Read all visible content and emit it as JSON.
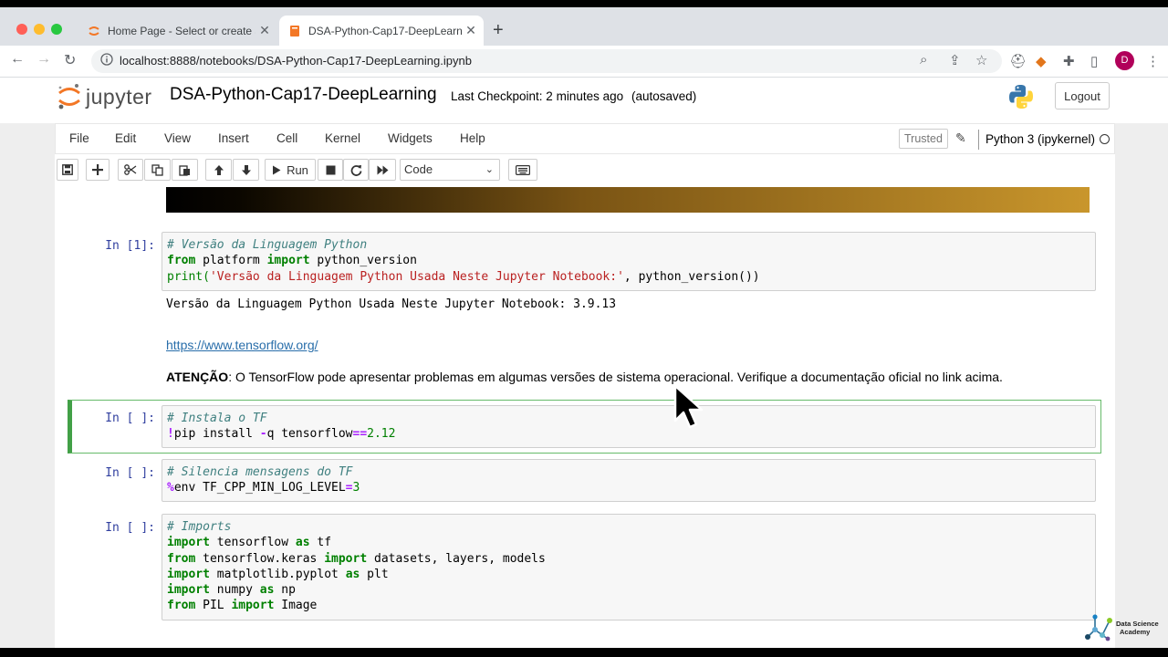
{
  "browser": {
    "tabs": [
      {
        "title": "Home Page - Select or create a",
        "active": false
      },
      {
        "title": "DSA-Python-Cap17-DeepLearni",
        "active": true
      }
    ],
    "url": "localhost:8888/notebooks/DSA-Python-Cap17-DeepLearning.ipynb",
    "profile_initial": "D"
  },
  "header": {
    "logo_text": "jupyter",
    "notebook_title": "DSA-Python-Cap17-DeepLearning",
    "checkpoint": "Last Checkpoint: 2 minutes ago",
    "autosave": "(autosaved)",
    "logout_label": "Logout"
  },
  "menu": {
    "items": [
      "File",
      "Edit",
      "View",
      "Insert",
      "Cell",
      "Kernel",
      "Widgets",
      "Help"
    ],
    "trusted_label": "Trusted",
    "kernel_name": "Python 3 (ipykernel)"
  },
  "toolbar": {
    "run_label": "Run",
    "cell_type": "Code"
  },
  "cells": {
    "c1": {
      "prompt": "In [1]:",
      "line1": "# Versão da Linguagem Python",
      "line2_from": "from",
      "line2_mid": " platform ",
      "line2_import": "import",
      "line2_rest": " python_version",
      "line3_fn": "print(",
      "line3_str": "'Versão da Linguagem Python Usada Neste Jupyter Notebook:'",
      "line3_rest": ", python_version())",
      "output": "Versão da Linguagem Python Usada Neste Jupyter Notebook: 3.9.13"
    },
    "md": {
      "link": "https://www.tensorflow.org/",
      "bold": "ATENÇÃO",
      "text": ": O TensorFlow pode apresentar problemas em algumas versões de sistema operacional. Verifique a documentação oficial no link acima."
    },
    "c2": {
      "prompt": "In [ ]:",
      "line1": "# Instala o TF",
      "bang": "!",
      "cmd": "pip install ",
      "flag": "-",
      "cmd2": "q tensorflow",
      "eq": "==",
      "ver": "2.12"
    },
    "c3": {
      "prompt": "In [ ]:",
      "line1": "# Silencia mensagens do TF",
      "pct": "%",
      "cmd": "env TF_CPP_MIN_LOG_LEVEL",
      "eq": "=",
      "val": "3"
    },
    "c4": {
      "prompt": "In [ ]:",
      "line1": "# Imports",
      "l2a": "import",
      "l2b": " tensorflow ",
      "l2c": "as",
      "l2d": " tf",
      "l3a": "from",
      "l3b": " tensorflow.keras ",
      "l3c": "import",
      "l3d": " datasets, layers, models",
      "l4a": "import",
      "l4b": " matplotlib.pyplot ",
      "l4c": "as",
      "l4d": " plt",
      "l5a": "import",
      "l5b": " numpy ",
      "l5c": "as",
      "l5d": " np",
      "l6a": "from",
      "l6b": " PIL ",
      "l6c": "import",
      "l6d": " Image"
    }
  },
  "watermark": {
    "line1": "Data Science",
    "line2": "Academy"
  },
  "colors": {
    "brand_orange": "#f37726",
    "link": "#296eaa",
    "selected_cell": "#42a047",
    "prompt": "#303f9f"
  }
}
